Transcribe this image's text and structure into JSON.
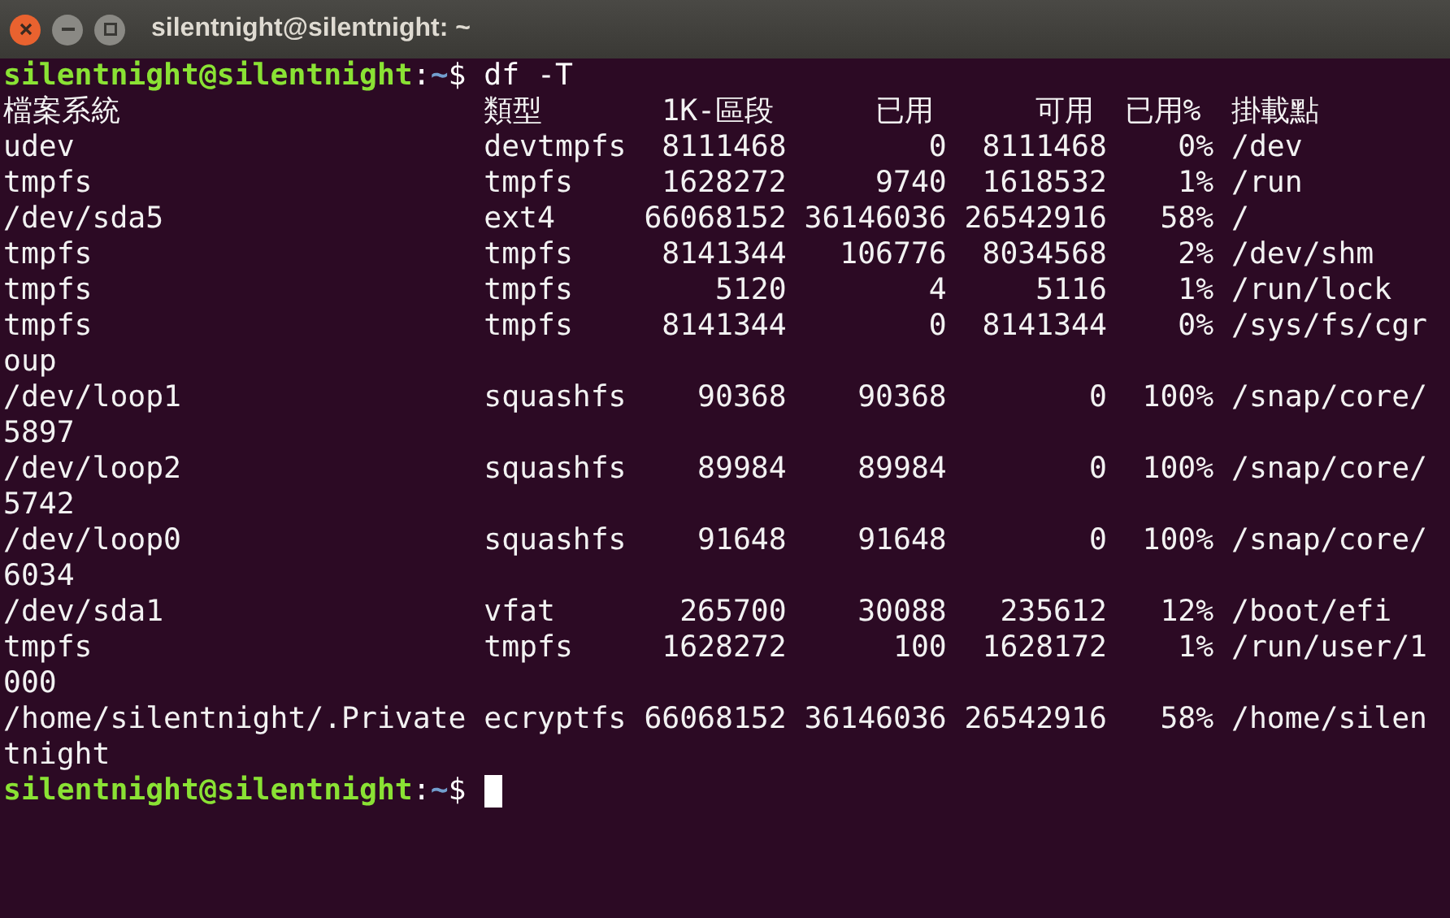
{
  "window": {
    "title": "silentnight@silentnight: ~"
  },
  "terminal": {
    "lines": [
      {
        "kind": "prompt",
        "user_host": "silentnight@silentnight",
        "separator": ":",
        "path": "~",
        "symbol": "$",
        "command": "df -T"
      },
      {
        "kind": "header",
        "columns": [
          "檔案系統",
          "類型",
          "1K-區段",
          "已用",
          "可用",
          "已用%",
          "掛載點"
        ]
      },
      {
        "kind": "row",
        "filesystem": "udev",
        "type": "devtmpfs",
        "blocks": "8111468",
        "used": "0",
        "available": "8111468",
        "use_pct": "0%",
        "mounted_on": "/dev"
      },
      {
        "kind": "row",
        "filesystem": "tmpfs",
        "type": "tmpfs",
        "blocks": "1628272",
        "used": "9740",
        "available": "1618532",
        "use_pct": "1%",
        "mounted_on": "/run"
      },
      {
        "kind": "row",
        "filesystem": "/dev/sda5",
        "type": "ext4",
        "blocks": "66068152",
        "used": "36146036",
        "available": "26542916",
        "use_pct": "58%",
        "mounted_on": "/"
      },
      {
        "kind": "row",
        "filesystem": "tmpfs",
        "type": "tmpfs",
        "blocks": "8141344",
        "used": "106776",
        "available": "8034568",
        "use_pct": "2%",
        "mounted_on": "/dev/shm"
      },
      {
        "kind": "row",
        "filesystem": "tmpfs",
        "type": "tmpfs",
        "blocks": "5120",
        "used": "4",
        "available": "5116",
        "use_pct": "1%",
        "mounted_on": "/run/lock"
      },
      {
        "kind": "row",
        "filesystem": "tmpfs",
        "type": "tmpfs",
        "blocks": "8141344",
        "used": "0",
        "available": "8141344",
        "use_pct": "0%",
        "mounted_on": "/sys/fs/cgroup"
      },
      {
        "kind": "row",
        "filesystem": "/dev/loop1",
        "type": "squashfs",
        "blocks": "90368",
        "used": "90368",
        "available": "0",
        "use_pct": "100%",
        "mounted_on": "/snap/core/5897"
      },
      {
        "kind": "row",
        "filesystem": "/dev/loop2",
        "type": "squashfs",
        "blocks": "89984",
        "used": "89984",
        "available": "0",
        "use_pct": "100%",
        "mounted_on": "/snap/core/5742"
      },
      {
        "kind": "row",
        "filesystem": "/dev/loop0",
        "type": "squashfs",
        "blocks": "91648",
        "used": "91648",
        "available": "0",
        "use_pct": "100%",
        "mounted_on": "/snap/core/6034"
      },
      {
        "kind": "row",
        "filesystem": "/dev/sda1",
        "type": "vfat",
        "blocks": "265700",
        "used": "30088",
        "available": "235612",
        "use_pct": "12%",
        "mounted_on": "/boot/efi"
      },
      {
        "kind": "row",
        "filesystem": "tmpfs",
        "type": "tmpfs",
        "blocks": "1628272",
        "used": "100",
        "available": "1628172",
        "use_pct": "1%",
        "mounted_on": "/run/user/1000"
      },
      {
        "kind": "row",
        "filesystem": "/home/silentnight/.Private",
        "type": "ecryptfs",
        "blocks": "66068152",
        "used": "36146036",
        "available": "26542916",
        "use_pct": "58%",
        "mounted_on": "/home/silentnight"
      },
      {
        "kind": "prompt",
        "user_host": "silentnight@silentnight",
        "separator": ":",
        "path": "~",
        "symbol": "$",
        "cursor": true
      }
    ]
  }
}
